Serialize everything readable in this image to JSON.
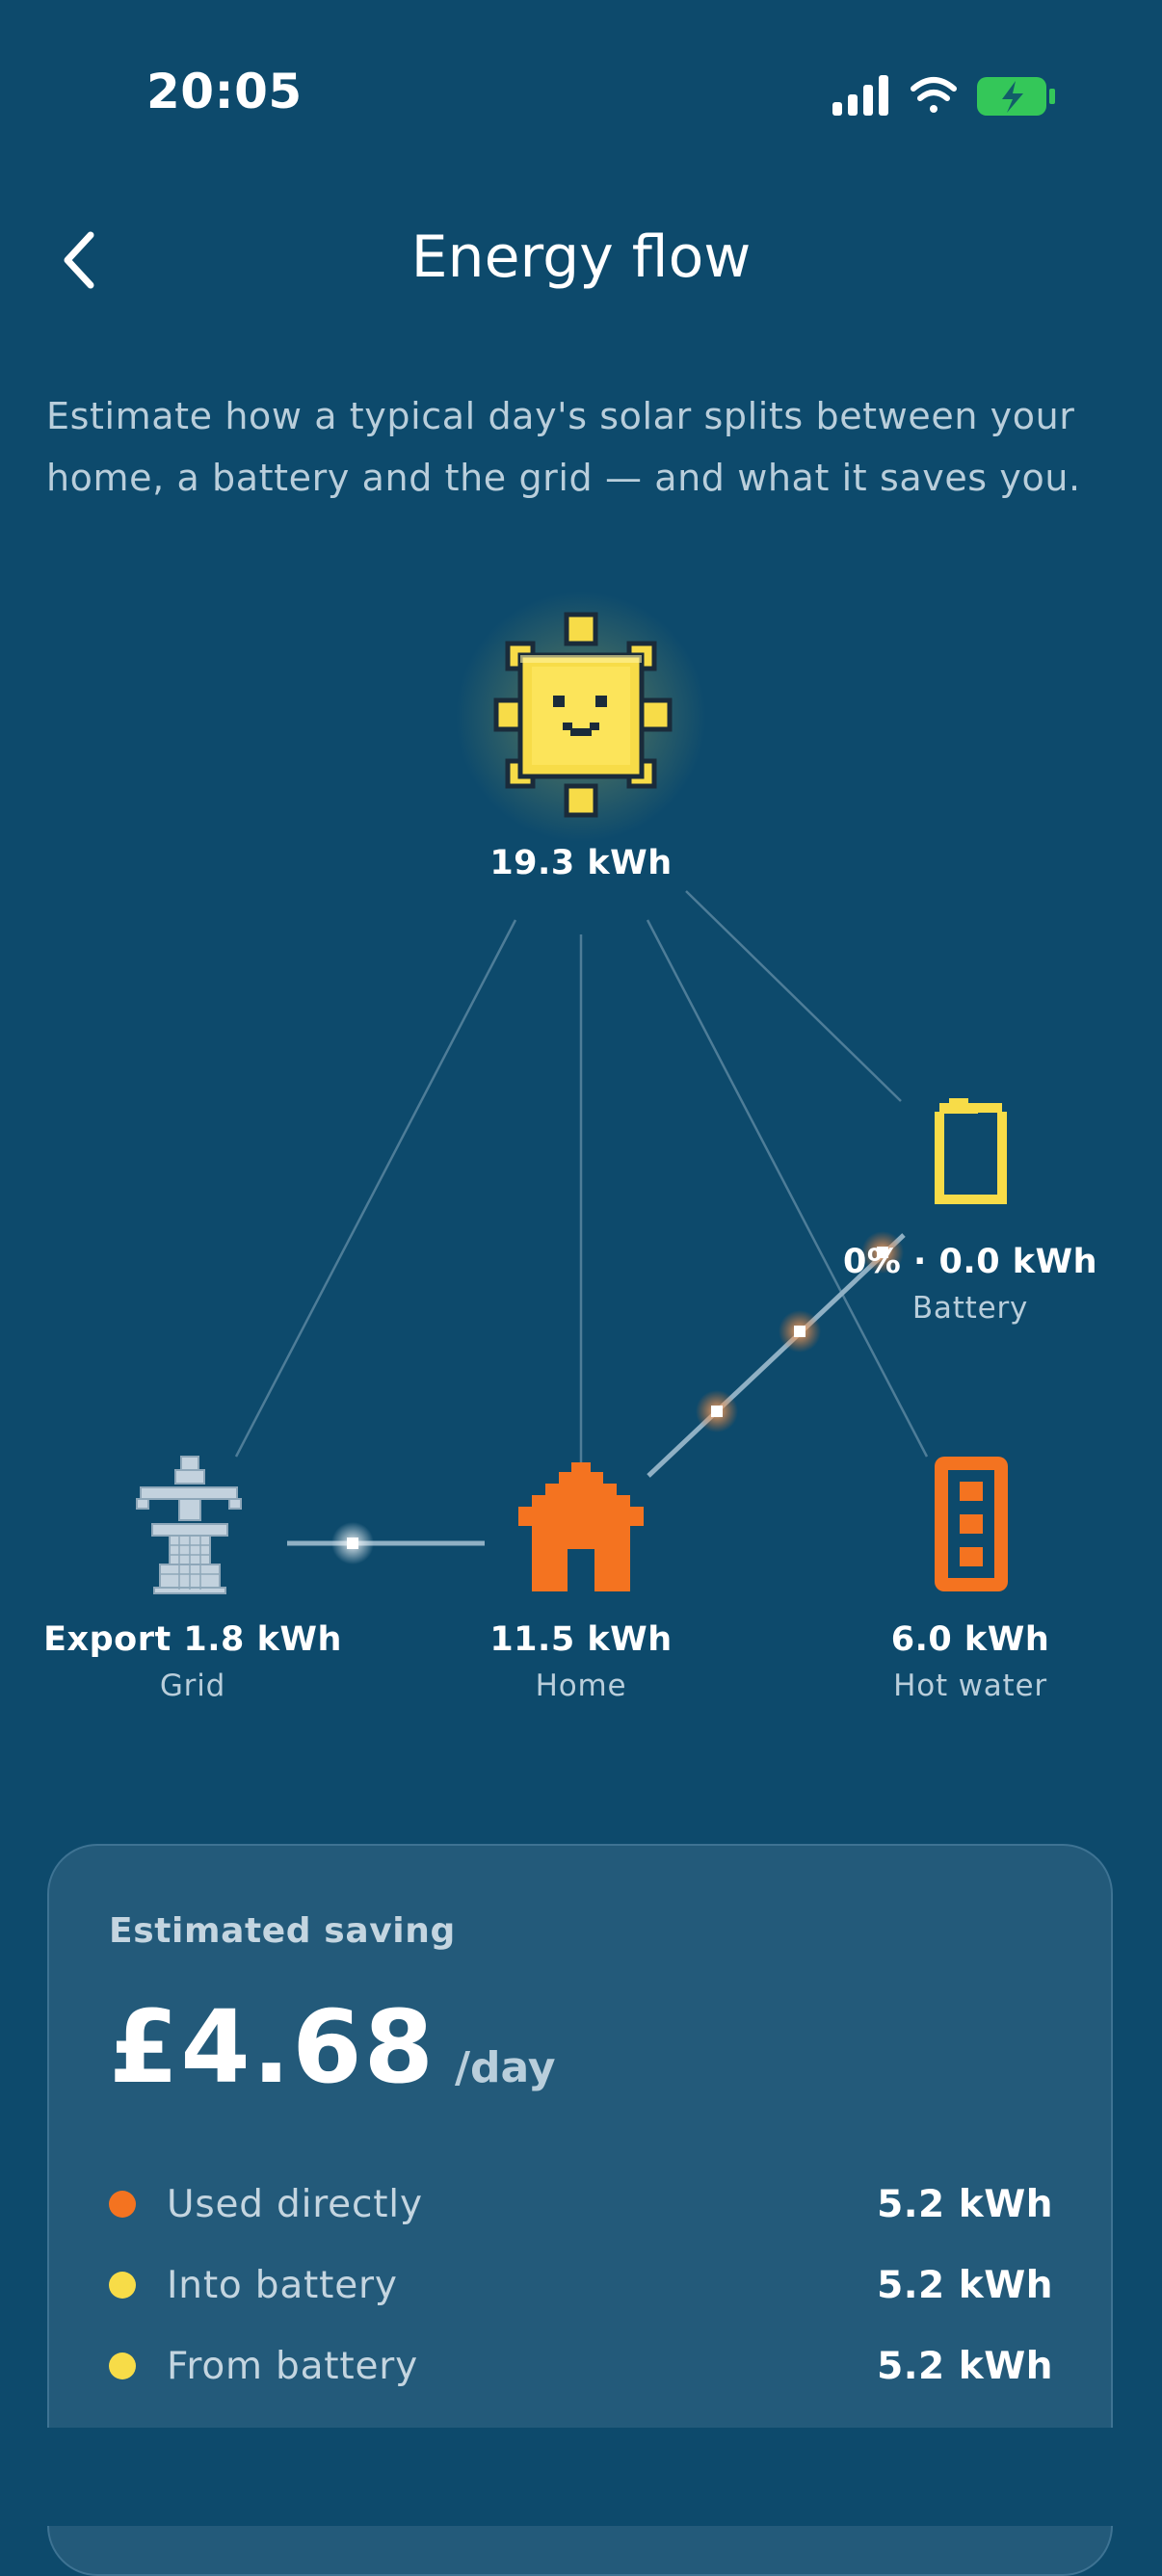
{
  "status_bar": {
    "time": "20:05"
  },
  "header": {
    "title": "Energy flow",
    "back_icon": "chevron-left-icon"
  },
  "intro": "Estimate how a typical day's solar splits between your home, a battery and the grid — and what it saves you.",
  "flow": {
    "solar": {
      "value": "19.3 kWh",
      "icon": "sun-icon"
    },
    "battery": {
      "value": "0% · 0.0 kWh",
      "label": "Battery",
      "icon": "battery-icon"
    },
    "grid": {
      "value": "Export 1.8 kWh",
      "label": "Grid",
      "icon": "pylon-icon"
    },
    "home": {
      "value": "11.5 kWh",
      "label": "Home",
      "icon": "house-icon"
    },
    "hot_water": {
      "value": "6.0 kWh",
      "label": "Hot water",
      "icon": "hot-water-tank-icon"
    }
  },
  "saving": {
    "label": "Estimated saving",
    "amount": "£4.68",
    "unit": "/day",
    "rows": [
      {
        "label": "Used directly",
        "value": "5.2 kWh",
        "color": "#f47320"
      },
      {
        "label": "Into battery",
        "value": "5.2 kWh",
        "color": "#f7dc48"
      },
      {
        "label": "From battery",
        "value": "5.2 kWh",
        "color": "#f7dc48"
      }
    ]
  },
  "colors": {
    "background": "#0d4a6c",
    "card": "#235a7a",
    "accent_orange": "#f47320",
    "accent_yellow": "#f7dc48"
  }
}
